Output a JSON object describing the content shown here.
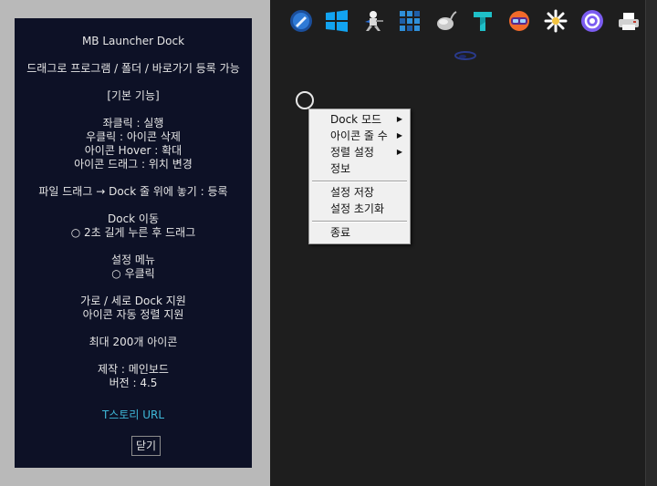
{
  "about": {
    "title": "MB Launcher Dock",
    "drag_register": "드래그로 프로그램 / 폴더 / 바로가기 등록 가능",
    "basic_header": "[기본 기능]",
    "left_click": "좌클릭 : 실행",
    "right_click": "우클릭 : 아이콘 삭제",
    "hover": "아이콘 Hover : 확대",
    "icon_drag": "아이콘 드래그 : 위치 변경",
    "file_drag": "파일 드래그 → Dock 줄 위에 놓기 : 등록",
    "dock_move_header": "Dock 이동",
    "dock_move_desc": "○ 2초 길게 누른 후 드래그",
    "settings_header": "설정 메뉴",
    "settings_desc": "○ 우클릭",
    "orientation": "가로 / 세로 Dock 지원",
    "auto_sort": "아이콘 자동 정렬 지원",
    "max_icons": "최대 200개 아이콘",
    "author": "제작 : 메인보드",
    "version": "버전 : 4.5",
    "link": "T스토리 URL",
    "close": "닫기"
  },
  "dock_icons": [
    "blue-pen-app-icon",
    "windows-icon",
    "robot-tool-icon",
    "grid-app-icon",
    "mouse-icon",
    "t-letter-icon",
    "vr-headset-icon",
    "flower-spark-icon",
    "chatgpt-icon",
    "printer-icon"
  ],
  "menu": {
    "dock_mode": "Dock 모드",
    "icons_per_row": "아이콘 줄 수",
    "sort_settings": "정렬 설정",
    "info": "정보",
    "save_settings": "설정 저장",
    "reset_settings": "설정 초기화",
    "exit": "종료",
    "submenu_arrow": "▶"
  }
}
